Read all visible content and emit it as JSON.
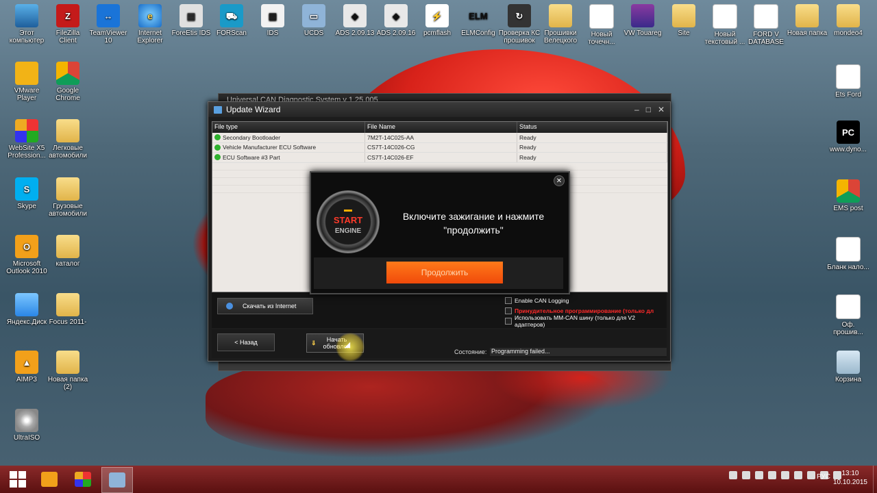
{
  "desktop": {
    "top_row": [
      {
        "label": "Этот компьютер",
        "icon": "computer-icon"
      },
      {
        "label": "FileZilla Client",
        "icon": "filezilla-icon"
      },
      {
        "label": "TeamViewer 10",
        "icon": "teamviewer-icon"
      },
      {
        "label": "Internet Explorer",
        "icon": "internet-explorer-icon"
      },
      {
        "label": "ForeEtis IDS",
        "icon": "foretis-icon"
      },
      {
        "label": "FORScan",
        "icon": "forscan-icon"
      },
      {
        "label": "IDS",
        "icon": "ids-icon"
      },
      {
        "label": "UCDS",
        "icon": "ucds-icon"
      },
      {
        "label": "ADS 2.09.13",
        "icon": "ads-icon"
      },
      {
        "label": "ADS 2.09.16",
        "icon": "ads-icon"
      },
      {
        "label": "pcmflash",
        "icon": "pcmflash-icon"
      },
      {
        "label": "ELMConfig",
        "icon": "elmconfig-icon"
      },
      {
        "label": "Проверка КС прошивок",
        "icon": "checksum-icon"
      },
      {
        "label": "Прошивки Велецкого",
        "icon": "folder-icon"
      },
      {
        "label": "Новый точечн...",
        "icon": "bitmap-file-icon"
      },
      {
        "label": "VW Touareg",
        "icon": "winrar-icon"
      },
      {
        "label": "Site",
        "icon": "folder-icon"
      },
      {
        "label": "Новый текстовый ...",
        "icon": "text-file-icon"
      },
      {
        "label": "FORD V DATABASE",
        "icon": "file-icon"
      },
      {
        "label": "Новая папка",
        "icon": "folder-icon"
      },
      {
        "label": "mondeo4",
        "icon": "folder-icon"
      }
    ],
    "left_col": [
      {
        "label": "VMware Player",
        "icon": "vmware-icon"
      },
      {
        "label": "Google Chrome",
        "icon": "chrome-icon"
      },
      {
        "label": "WebSite X5 Profession...",
        "icon": "website-x5-icon"
      },
      {
        "label": "Легковые автомобили",
        "icon": "folder-icon"
      },
      {
        "label": "Skype",
        "icon": "skype-icon"
      },
      {
        "label": "Грузовые автомобили",
        "icon": "folder-icon"
      },
      {
        "label": "Microsoft Outlook 2010",
        "icon": "outlook-icon"
      },
      {
        "label": "каталог",
        "icon": "folder-icon"
      },
      {
        "label": "Яндекс.Диск",
        "icon": "yandex-disk-icon"
      },
      {
        "label": "Focus 2011-",
        "icon": "folder-icon"
      },
      {
        "label": "AIMP3",
        "icon": "aimp-icon"
      },
      {
        "label": "Новая папка (2)",
        "icon": "folder-icon"
      },
      {
        "label": "UltraISO",
        "icon": "ultraiso-icon"
      }
    ],
    "right_col": [
      {
        "label": "Ets Ford",
        "icon": "file-icon"
      },
      {
        "label": "www.dyno...",
        "icon": "pc-icon"
      },
      {
        "label": "EMS post",
        "icon": "chrome-icon"
      },
      {
        "label": "Бланк нало...",
        "icon": "document-icon"
      },
      {
        "label": "Оф. прошив...",
        "icon": "document-icon"
      },
      {
        "label": "Корзина",
        "icon": "recycle-bin-icon"
      }
    ]
  },
  "bg_window": {
    "title": "Universal CAN Diagnostic System v 1.25.005"
  },
  "wizard": {
    "title": "Update Wizard",
    "columns": [
      "File type",
      "File Name",
      "Status"
    ],
    "rows": [
      {
        "type": "Secondary Bootloader",
        "name": "7M2T-14C025-AA",
        "status": "Ready"
      },
      {
        "type": "Vehicle Manufacturer ECU Software",
        "name": "CS7T-14C026-CG",
        "status": "Ready"
      },
      {
        "type": "ECU Software #3 Part",
        "name": "CS7T-14C026-EF",
        "status": "Ready"
      }
    ],
    "download_button": "Скачать из Internet",
    "options": {
      "can_logging": "Enable CAN Logging",
      "force_programming": "Принудительное программирование (только дл",
      "mm_can": "Использовать MM-CAN шину (только для V2 адаптеров)"
    },
    "back_button": "< Назад",
    "start_button": [
      "Начать",
      "обновлен"
    ],
    "status_label": "Состояние:",
    "status_value": "Programming failed..."
  },
  "modal": {
    "engine_top": "START",
    "engine_bottom": "ENGINE",
    "message_line1": "Включите зажигание и нажмите",
    "message_line2": "\"продолжить\"",
    "continue_button": "Продолжить"
  },
  "taskbar": {
    "language": "РУС",
    "time": "13:10",
    "date": "10.10.2015"
  }
}
